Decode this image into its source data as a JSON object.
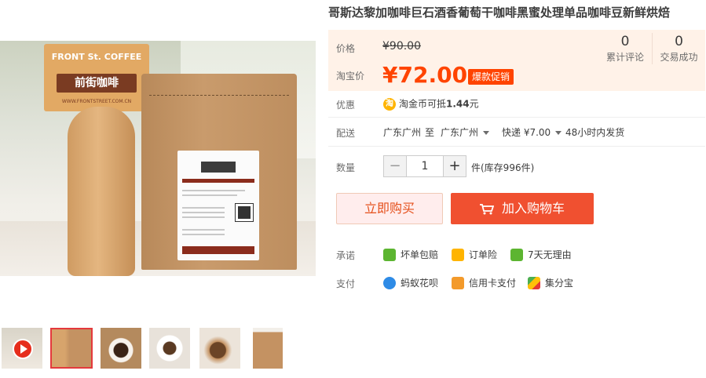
{
  "product": {
    "title": "哥斯达黎加咖啡巨石酒香葡萄干咖啡黑蜜处理单品咖啡豆新鲜烘焙"
  },
  "gallery": {
    "sign_brand_en": "FRONT St. COFFEE",
    "sign_brand_cn": "前街咖啡",
    "sign_url": "WWW.FRONTSTREET.COM.CN",
    "thumbnails": [
      {
        "name": "video-thumbnail",
        "has_play": true
      },
      {
        "name": "coffee-bag-front",
        "active": true
      },
      {
        "name": "coffee-cup-top"
      },
      {
        "name": "coffee-cup-saucer"
      },
      {
        "name": "coffee-latte"
      },
      {
        "name": "coffee-bag-small"
      }
    ]
  },
  "price": {
    "original_label": "价格",
    "original": "¥90.00",
    "taobao_label": "淘宝价",
    "taobao": "¥72.00",
    "promo_badge": "爆款促销",
    "reviews_count": "0",
    "reviews_label": "累计评论",
    "sales_count": "0",
    "sales_label": "交易成功"
  },
  "discount": {
    "label": "优惠",
    "icon_text": "淘",
    "text_prefix": "淘金币可抵",
    "amount": "1.44",
    "text_suffix": "元"
  },
  "delivery": {
    "label": "配送",
    "from": "广东广州",
    "to_word": "至",
    "to": "广东广州",
    "shipping": "快递 ¥7.00",
    "dispatch": "48小时内发货"
  },
  "quantity": {
    "label": "数量",
    "minus": "−",
    "value": "1",
    "plus": "+",
    "stock": "件(库存996件)"
  },
  "actions": {
    "buy_now": "立即购买",
    "add_to_cart": "加入购物车"
  },
  "promise": {
    "label": "承诺",
    "items": [
      "坏单包赔",
      "订单险",
      "7天无理由"
    ]
  },
  "payment": {
    "label": "支付",
    "items": [
      "蚂蚁花呗",
      "信用卡支付",
      "集分宝"
    ]
  },
  "colors": {
    "accent": "#ff4400",
    "promo": "#ff4400",
    "cart_button": "#f05030",
    "price_bg": "#fff2e8"
  }
}
